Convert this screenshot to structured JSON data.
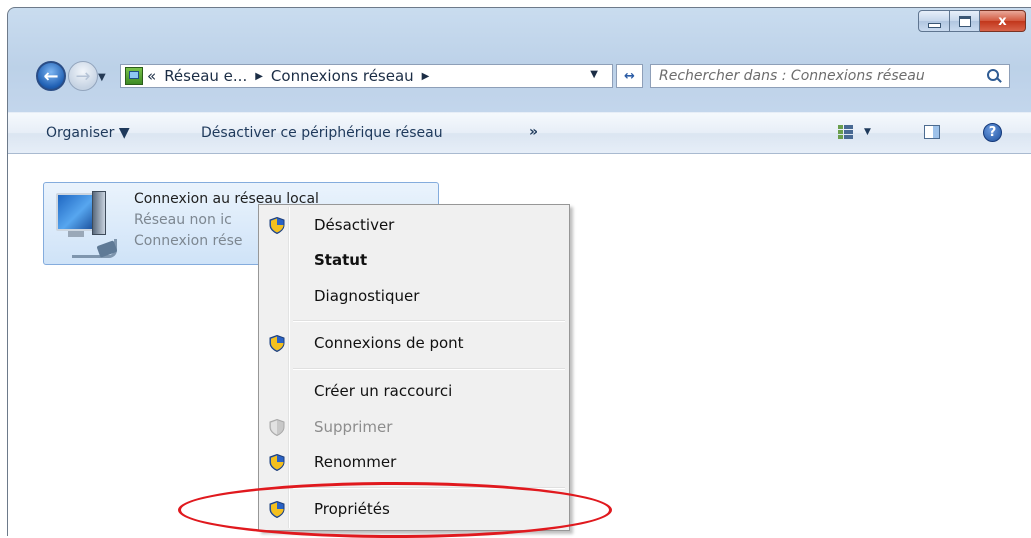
{
  "window": {
    "caption_buttons": {
      "minimize_icon": "minimize-icon",
      "maximize_icon": "maximize-icon",
      "close_label": "x"
    }
  },
  "addressbar": {
    "overflow": "«",
    "crumbs": [
      "Réseau e...",
      "Connexions réseau"
    ],
    "crumb_separator": "▶",
    "dropdown": "▼",
    "refresh_glyph": "↔"
  },
  "search": {
    "placeholder": "Rechercher dans : Connexions réseau",
    "icon": "search-icon"
  },
  "nav": {
    "back_glyph": "←",
    "forward_glyph": "→",
    "dropdown_glyph": "▼"
  },
  "toolbar": {
    "organiser": "Organiser ▼",
    "desactiver": "Désactiver ce périphérique réseau",
    "more": "»",
    "views_caret": "▼",
    "help": "?"
  },
  "network_item": {
    "name": "Connexion au réseau local",
    "status": "Réseau non ic",
    "adapter": "Connexion rése"
  },
  "context_menu": {
    "items": [
      {
        "label": "Désactiver",
        "icon": "uac-shield-icon",
        "bold": false,
        "disabled": false
      },
      {
        "label": "Statut",
        "icon": "",
        "bold": true,
        "disabled": false
      },
      {
        "label": "Diagnostiquer",
        "icon": "",
        "bold": false,
        "disabled": false
      },
      {
        "label": "Connexions de pont",
        "icon": "uac-shield-icon",
        "bold": false,
        "disabled": false
      },
      {
        "label": "Créer un raccourci",
        "icon": "",
        "bold": false,
        "disabled": false
      },
      {
        "label": "Supprimer",
        "icon": "uac-shield-disabled-icon",
        "bold": false,
        "disabled": true
      },
      {
        "label": "Renommer",
        "icon": "uac-shield-icon",
        "bold": false,
        "disabled": false
      },
      {
        "label": "Propriétés",
        "icon": "uac-shield-icon",
        "bold": false,
        "disabled": false
      }
    ]
  },
  "highlight": {
    "color": "#e0191e",
    "target": "Propriétés"
  }
}
